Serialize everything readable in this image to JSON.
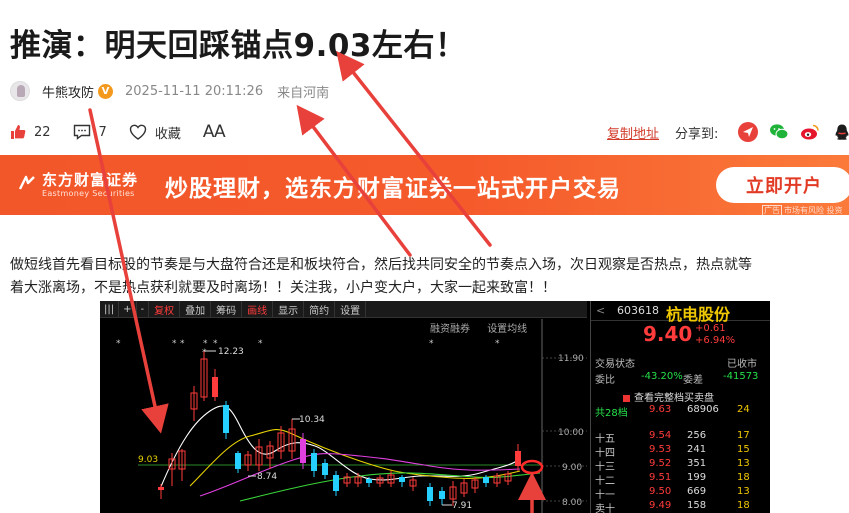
{
  "article": {
    "title": "推演：明天回踩锚点9.03左右！",
    "author": "牛熊攻防",
    "verified_badge": "V",
    "time": "2025-11-11 20:11:26",
    "source": "来自河南",
    "like_count": "22",
    "comment_count": "7",
    "favorite_label": "收藏",
    "font_size_label": "AA",
    "copy_link_label": "复制地址",
    "share_label": "分享到:",
    "paragraph_line1": "做短线首先看目标股的节奏是与大盘符合还是和板块符合，然后找共同安全的节奏点入场，次日观察是否热点，热点就等",
    "paragraph_line2": "着大涨离场，不是热点获利就要及时离场！！关注我，小户变大户，大家一起来致富！！"
  },
  "banner": {
    "logo_cn": "东方财富证券",
    "logo_en": "Eastmoney Securities",
    "slogan": "炒股理财，选东方财富证券一站式开户交易",
    "cta_label": "立即开户",
    "ad_tag": "广告",
    "ad_note": "市场有风险 投资需谨慎"
  },
  "chart_toolbar": {
    "items": [
      "|||",
      "+",
      "-",
      "复权",
      "叠加",
      "筹码",
      "画线",
      "显示",
      "简约",
      "设置"
    ],
    "sub_items": [
      "融资融券",
      "设置均线"
    ]
  },
  "kline": {
    "price_ticks": [
      "11.90",
      "11.00",
      "10.00",
      "9.00",
      "8.00"
    ],
    "annotations": [
      "12.23",
      "10.34",
      "9.03",
      "8.74",
      "7.91"
    ],
    "anchor_label": "9.03"
  },
  "quote": {
    "code": "603618",
    "name": "杭电股份",
    "price": "9.40",
    "change": "+0.61",
    "change_pct": "+6.94%",
    "status_label": "交易状态",
    "status_value": "已收市",
    "ratio_label": "委比",
    "ratio_value": "-43.20%",
    "diff_label": "委差",
    "diff_value": "-41573",
    "full_book_label": "查看完整档买卖盘",
    "book_rows": [
      {
        "level": "共28档",
        "price": "9.63",
        "volume": "68906",
        "orders": "24"
      },
      {
        "level": "十五",
        "price": "9.54",
        "volume": "256",
        "orders": "17"
      },
      {
        "level": "十四",
        "price": "9.53",
        "volume": "241",
        "orders": "15"
      },
      {
        "level": "十三",
        "price": "9.52",
        "volume": "351",
        "orders": "13"
      },
      {
        "level": "十二",
        "price": "9.51",
        "volume": "199",
        "orders": "18"
      },
      {
        "level": "十一",
        "price": "9.50",
        "volume": "669",
        "orders": "13"
      },
      {
        "level": "卖十",
        "price": "9.49",
        "volume": "158",
        "orders": "18"
      }
    ]
  },
  "colors": {
    "accent_red": "#d23b2a",
    "banner_orange": "#f2572a",
    "price_up": "#ff3b3b",
    "price_down": "#25e04a",
    "stock_name_yellow": "#f0c800",
    "arrow_red": "#e8413b"
  }
}
